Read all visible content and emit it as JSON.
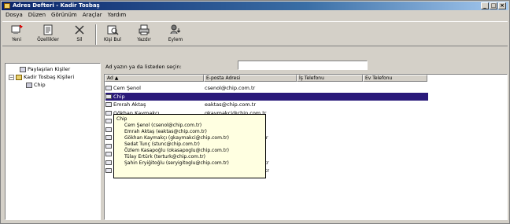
{
  "window": {
    "title": "Adres Defteri - Kadir Tosbaş",
    "buttons": [
      "_",
      "□",
      "×"
    ]
  },
  "menu": [
    "Dosya",
    "Düzen",
    "Görünüm",
    "Araçlar",
    "Yardım"
  ],
  "toolbar": [
    {
      "label": "Yeni",
      "icon": "new-contact-icon"
    },
    {
      "label": "Özellikler",
      "icon": "properties-icon"
    },
    {
      "label": "Sil",
      "icon": "delete-icon"
    },
    {
      "label": "Kişi Bul",
      "icon": "find-people-icon"
    },
    {
      "label": "Yazdır",
      "icon": "print-icon"
    },
    {
      "label": "Eylem",
      "icon": "action-icon"
    }
  ],
  "tree": [
    {
      "label": "Paylaşılan Kişiler",
      "icon": "shared-contacts-icon"
    },
    {
      "label": "Kadir Tosbaş Kişileri",
      "icon": "folder-icon"
    },
    {
      "label": "Chip",
      "icon": "group-icon"
    }
  ],
  "search": {
    "label": "Ad yazın ya da listeden seçin:",
    "value": ""
  },
  "columns": [
    "Ad",
    "E-posta Adresi",
    "İş Telefonu",
    "Ev Telefonu"
  ],
  "rows": [
    {
      "name": "Cem Şenol",
      "email": "csenol@chip.com.tr",
      "selected": false
    },
    {
      "name": "Chip",
      "email": "",
      "selected": true
    },
    {
      "name": "Emrah Aktaş",
      "email": "eaktas@chip.com.tr",
      "selected": false
    },
    {
      "name": "Gökhan Kaymakçı",
      "email": "gkaymakci@chip.com.tr",
      "selected": false
    },
    {
      "name": "Ercan Kuzu",
      "email": "ekuzu@chip.com.tr",
      "selected": false
    },
    {
      "name": "Sedat Tunç",
      "email": "stunc@chip.com.tr",
      "selected": false
    },
    {
      "name": "Özlem Kasapoğlu",
      "email": "okasapoglu@chip.com.tr",
      "selected": false
    },
    {
      "name": "Tülay Ertürk",
      "email": "terturk@chip.com.tr",
      "selected": false
    },
    {
      "name": "Serdar Paç",
      "email": "spac@chip.com.tr",
      "selected": false
    },
    {
      "name": "Şahin Eryiğitoğlu",
      "email": "seryigitoglu@chip.com.tr",
      "selected": false
    },
    {
      "name": "Ufuk Yalçınkaya",
      "email": "uyalcinkaya@chip.com.tr",
      "selected": false
    }
  ],
  "tooltip": {
    "title": "Chip",
    "items": [
      "Cem Şenol (csenol@chip.com.tr)",
      "Emrah Aktaş (eaktas@chip.com.tr)",
      "Gökhan Kaymakçı (gkaymakci@chip.com.tr)",
      "Sedat Tunç (stunc@chip.com.tr)",
      "Özlem Kasapoğlu (okasapoglu@chip.com.tr)",
      "Tülay Ertürk (terturk@chip.com.tr)",
      "Şahin Eryiğitoğlu (seryigitoglu@chip.com.tr)"
    ]
  }
}
